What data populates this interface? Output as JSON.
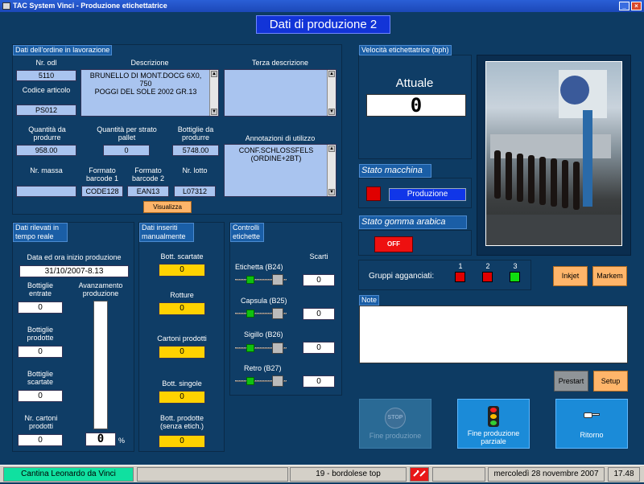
{
  "window": {
    "title": "TAC System Vinci - Produzione etichettatrice"
  },
  "header": {
    "title": "Dati di produzione 2"
  },
  "ordine": {
    "section": "Dati dell'ordine in lavorazione",
    "nr_odl_label": "Nr. odl",
    "nr_odl": "5110",
    "codice_label": "Codice articolo",
    "codice": "PS012",
    "descrizione_label": "Descrizione",
    "descrizione": "BRUNELLO DI MONT.DOCG  6X0, 750\nPOGGI DEL SOLE 2002 GR.13",
    "terza_label": "Terza descrizione",
    "terza": "",
    "quantita_label": "Quantità da produrre",
    "quantita": "958.00",
    "strato_label": "Quantità per strato pallet",
    "strato": "0",
    "bottiglie_label": "Bottiglie da produrre",
    "bottiglie": "5748.00",
    "annotazioni_label": "Annotazioni di utilizzo",
    "annotazioni": "CONF.SCHLOSSFELS\n(ORDINE+2BT)",
    "massa_label": "Nr. massa",
    "massa": "",
    "barcode1_label": "Formato barcode 1",
    "barcode1": "CODE128",
    "barcode2_label": "Formato barcode 2",
    "barcode2": "EAN13",
    "lotto_label": "Nr. lotto",
    "lotto": "L07312",
    "visualizza": "Visualizza"
  },
  "rilevati": {
    "section": "Dati rilevati in tempo reale",
    "data_label": "Data ed ora inizio produzione",
    "data": "31/10/2007-8.13",
    "entrate_label": "Bottiglie entrate",
    "entrate": "0",
    "prodotte_label": "Bottiglie prodotte",
    "prodotte": "0",
    "scartate_label": "Bottiglie scartate",
    "scartate": "0",
    "cartoni_label": "Nr. cartoni prodotti",
    "cartoni": "0",
    "avanz_label": "Avanzamento produzione",
    "avanz": "0",
    "avanz_unit": "%"
  },
  "manuali": {
    "section": "Dati inseriti manualmente",
    "scartate_label": "Bott. scartate",
    "scartate": "0",
    "rotture_label": "Rotture",
    "rotture": "0",
    "cartoni_label": "Cartoni prodotti",
    "cartoni": "0",
    "singole_label": "Bott. singole",
    "singole": "0",
    "senza_label": "Bott. prodotte (senza etich.)",
    "senza": "0"
  },
  "controlli": {
    "section": "Controlli etichette",
    "scarti_label": "Scarti",
    "items": [
      {
        "label": "Etichetta (B24)",
        "value": "0"
      },
      {
        "label": "Capsula (B25)",
        "value": "0"
      },
      {
        "label": "Sigillo (B26)",
        "value": "0"
      },
      {
        "label": "Retro (B27)",
        "value": "0"
      }
    ]
  },
  "velocita": {
    "section": "Velocità etichettatrice (bph)",
    "attuale_label": "Attuale",
    "attuale": "0"
  },
  "stato_macchina": {
    "section": "Stato macchina",
    "value": "Produzione",
    "led_color": "#e00000"
  },
  "stato_gomma": {
    "section": "Stato gomma arabica",
    "value": "OFF"
  },
  "gruppi": {
    "label": "Gruppi agganciati:",
    "nums": [
      "1",
      "2",
      "3"
    ],
    "colors": [
      "#e00000",
      "#e00000",
      "#10dd10"
    ]
  },
  "buttons": {
    "inkjet": "Inkjet",
    "markem": "Markem",
    "prestart": "Prestart",
    "setup": "Setup"
  },
  "note": {
    "section": "Note",
    "value": ""
  },
  "bottom": {
    "stop_icon": "STOP",
    "fine": "Fine produzione",
    "parziale": "Fine produzione parziale",
    "ritorno": "Ritorno"
  },
  "status": {
    "cantina": "Cantina Leonardo da Vinci",
    "linea": "19 - bordolese top",
    "data": "mercoledì 28 novembre 2007",
    "ora": "17.48"
  }
}
